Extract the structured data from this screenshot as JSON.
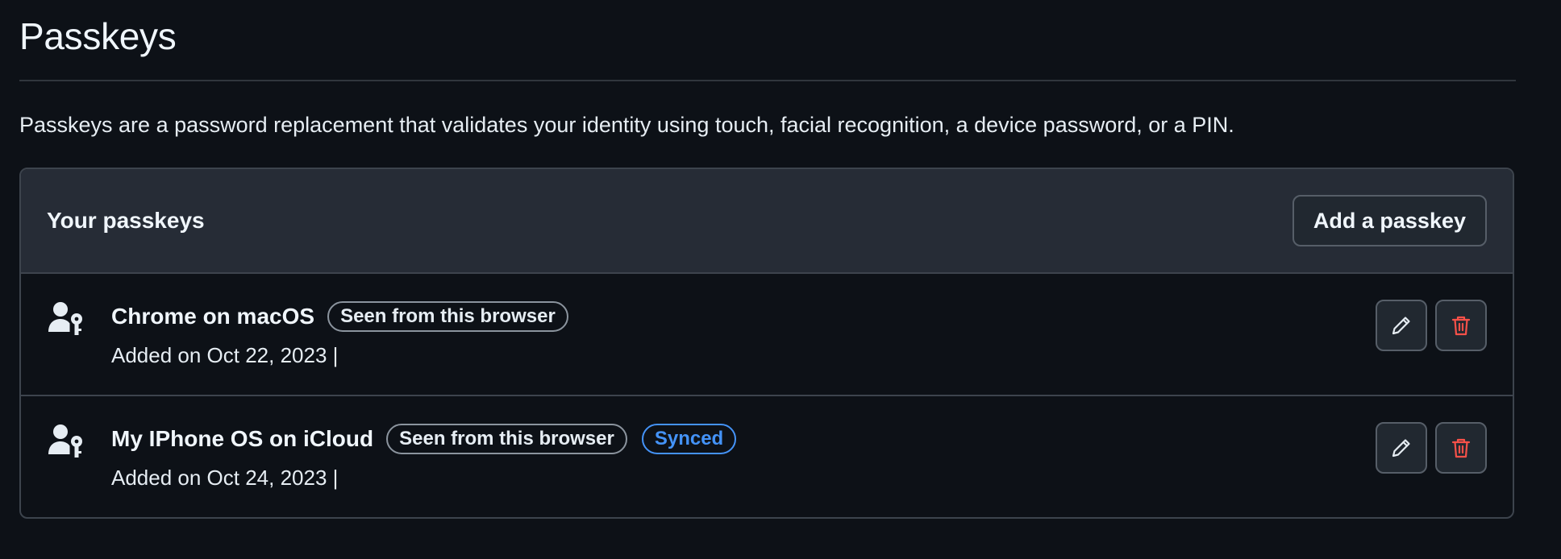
{
  "page": {
    "title": "Passkeys",
    "description": "Passkeys are a password replacement that validates your identity using touch, facial recognition, a device password, or a PIN."
  },
  "passkeys_box": {
    "header_title": "Your passkeys",
    "add_button_label": "Add a passkey",
    "items": [
      {
        "icon": "person-key-icon",
        "name": "Chrome on macOS",
        "badges": [
          "Seen from this browser"
        ],
        "added": "Added on Oct 22, 2023 |"
      },
      {
        "icon": "person-key-icon",
        "name": "My IPhone OS on iCloud",
        "badges": [
          "Seen from this browser",
          "Synced"
        ],
        "added": "Added on Oct 24, 2023 |"
      }
    ],
    "row_actions": [
      "pencil-icon",
      "trash-icon"
    ]
  },
  "colors": {
    "background": "#0d1117",
    "header_background": "#262c36",
    "border": "#3d444d",
    "synced_accent": "#4493f8",
    "danger": "#f85149"
  }
}
